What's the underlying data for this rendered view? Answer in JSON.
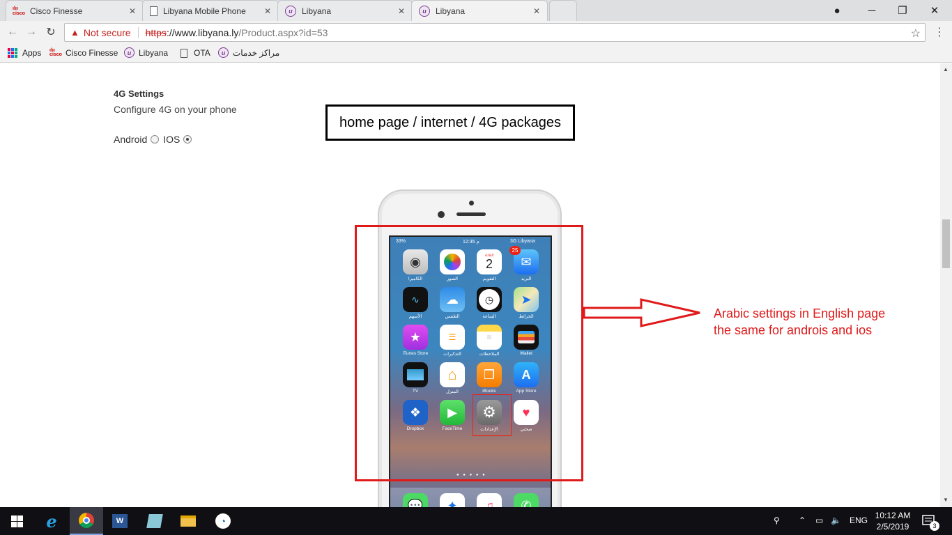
{
  "browser": {
    "tabs": [
      {
        "title": "Cisco Finesse",
        "favicon": "cisco-favicon"
      },
      {
        "title": "Libyana Mobile Phone",
        "favicon": "document-favicon"
      },
      {
        "title": "Libyana",
        "favicon": "libyana-favicon"
      },
      {
        "title": "Libyana",
        "favicon": "libyana-favicon",
        "active": true
      }
    ],
    "security_label": "Not secure",
    "url_scheme": "https",
    "url_host": "://www.libyana.ly",
    "url_path": "/Product.aspx?id=53",
    "bookmarks": [
      {
        "label": "Apps",
        "icon": "apps-grid-icon"
      },
      {
        "label": "Cisco Finesse",
        "icon": "cisco-icon"
      },
      {
        "label": "Libyana",
        "icon": "libyana-icon"
      },
      {
        "label": "OTA",
        "icon": "page-icon"
      },
      {
        "label": "مراكز خدمات",
        "icon": "libyana-icon"
      }
    ]
  },
  "page": {
    "settings_title": "4G Settings",
    "settings_desc": "Configure 4G on your phone",
    "os_options": [
      {
        "label": "Android",
        "selected": false
      },
      {
        "label": "IOS",
        "selected": true
      }
    ],
    "breadcrumb_note": "home page / internet / 4G packages",
    "annotation_lines": [
      "Arabic settings in English page",
      "the same for androis and ios"
    ]
  },
  "phone": {
    "status_battery": "33%",
    "status_time": "12:35 م",
    "status_carrier": "3G  Libyana",
    "calendar_day_label": "الثلاثاء",
    "calendar_date": "2",
    "mail_badge": "25",
    "apps": [
      {
        "label": "الكاميرا",
        "icon": "camera-icon"
      },
      {
        "label": "الصور",
        "icon": "photos-icon"
      },
      {
        "label": "التقويم",
        "icon": "calendar-icon"
      },
      {
        "label": "البريد",
        "icon": "mail-icon"
      },
      {
        "label": "الأسهم",
        "icon": "stocks-icon"
      },
      {
        "label": "الطقس",
        "icon": "weather-icon"
      },
      {
        "label": "الساعة",
        "icon": "clock-icon"
      },
      {
        "label": "الخرائط",
        "icon": "maps-icon"
      },
      {
        "label": "iTunes Store",
        "icon": "itunes-store-icon"
      },
      {
        "label": "التذكيرات",
        "icon": "reminders-icon"
      },
      {
        "label": "الملاحظات",
        "icon": "notes-icon"
      },
      {
        "label": "Wallet",
        "icon": "wallet-icon"
      },
      {
        "label": "TV",
        "icon": "tv-icon"
      },
      {
        "label": "المنزل",
        "icon": "home-icon"
      },
      {
        "label": "iBooks",
        "icon": "ibooks-icon"
      },
      {
        "label": "App Store",
        "icon": "app-store-icon"
      },
      {
        "label": "Dropbox",
        "icon": "dropbox-icon"
      },
      {
        "label": "FaceTime",
        "icon": "facetime-icon"
      },
      {
        "label": "الإعدادات",
        "icon": "settings-gear-icon"
      },
      {
        "label": "صحتي",
        "icon": "health-icon"
      }
    ]
  },
  "taskbar": {
    "language": "ENG",
    "time": "10:12 AM",
    "date": "2/5/2019",
    "notification_count": "3"
  },
  "colors": {
    "annotation_red": "#e01a1a",
    "insecure_red": "#c5221f",
    "taskbar_bg": "#101014"
  }
}
